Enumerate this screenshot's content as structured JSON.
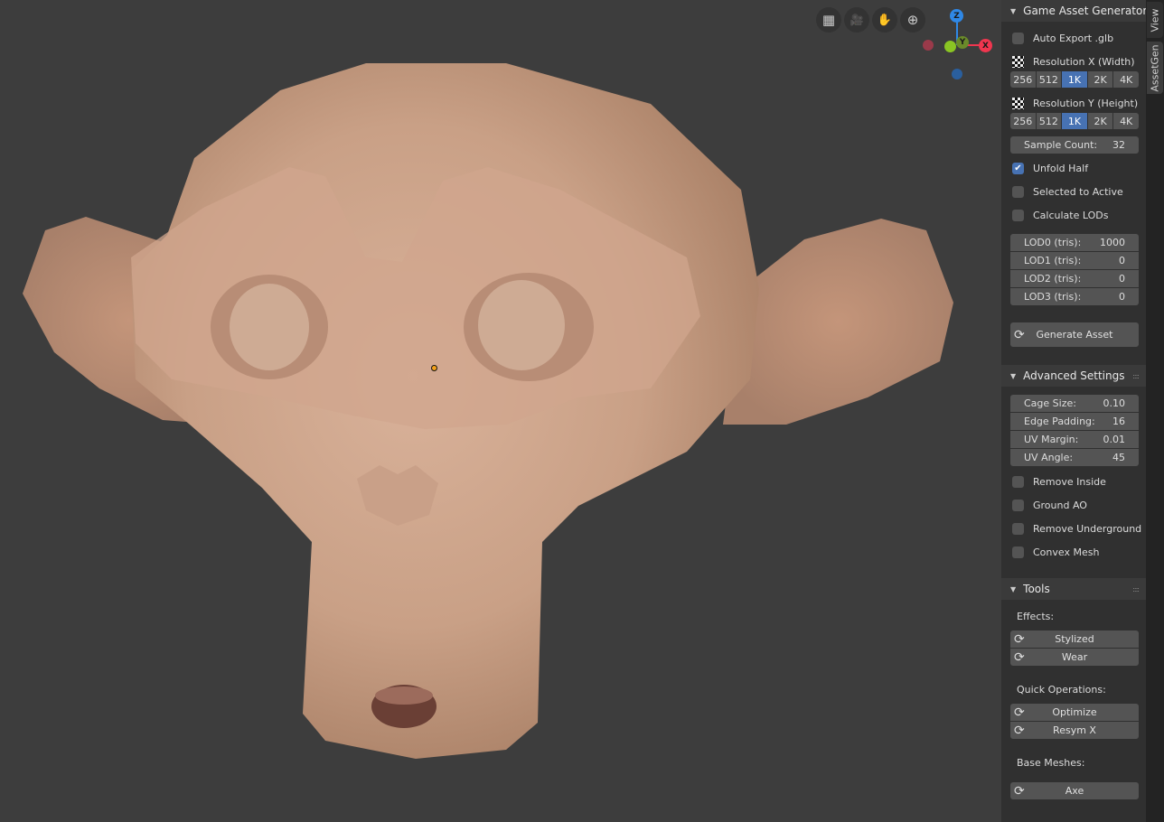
{
  "viewport": {
    "nav_buttons": [
      {
        "icon": "grid-icon",
        "glyph": "▦"
      },
      {
        "icon": "camera-icon",
        "glyph": "🎥"
      },
      {
        "icon": "hand-icon",
        "glyph": "✋"
      },
      {
        "icon": "zoom-icon",
        "glyph": "⊕"
      }
    ],
    "gizmo": {
      "z": "Z",
      "y": "Y",
      "x": "X",
      "colors": {
        "x": "#f0364f",
        "y": "#8ac523",
        "z": "#2f88e6"
      }
    }
  },
  "tabs": {
    "view": "View",
    "assetgen": "AssetGen"
  },
  "panel_main": {
    "title": "Game Asset Generator",
    "auto_export": {
      "label": "Auto Export .glb",
      "checked": false
    },
    "res_x": {
      "label": "Resolution X (Width)",
      "options": [
        "256",
        "512",
        "1K",
        "2K",
        "4K"
      ],
      "selected": "1K"
    },
    "res_y": {
      "label": "Resolution Y (Height)",
      "options": [
        "256",
        "512",
        "1K",
        "2K",
        "4K"
      ],
      "selected": "1K"
    },
    "sample_count": {
      "label": "Sample Count:",
      "value": "32"
    },
    "unfold_half": {
      "label": "Unfold Half",
      "checked": true
    },
    "selected_to_active": {
      "label": "Selected to Active",
      "checked": false
    },
    "calculate_lods": {
      "label": "Calculate LODs",
      "checked": false
    },
    "lods": [
      {
        "label": "LOD0 (tris):",
        "value": "1000"
      },
      {
        "label": "LOD1 (tris):",
        "value": "0"
      },
      {
        "label": "LOD2 (tris):",
        "value": "0"
      },
      {
        "label": "LOD3 (tris):",
        "value": "0"
      }
    ],
    "generate": "Generate Asset"
  },
  "panel_advanced": {
    "title": "Advanced Settings",
    "fields": [
      {
        "label": "Cage Size:",
        "value": "0.10"
      },
      {
        "label": "Edge Padding:",
        "value": "16"
      },
      {
        "label": "UV Margin:",
        "value": "0.01"
      },
      {
        "label": "UV Angle:",
        "value": "45"
      }
    ],
    "checks": [
      {
        "label": "Remove Inside",
        "checked": false
      },
      {
        "label": "Ground AO",
        "checked": false
      },
      {
        "label": "Remove Underground",
        "checked": false
      },
      {
        "label": "Convex Mesh",
        "checked": false
      }
    ]
  },
  "panel_tools": {
    "title": "Tools",
    "effects_label": "Effects:",
    "effects": [
      "Stylized",
      "Wear"
    ],
    "quick_label": "Quick Operations:",
    "quick": [
      "Optimize",
      "Resym X"
    ],
    "base_label": "Base Meshes:",
    "base": [
      "Axe"
    ]
  },
  "check_glyph": "✔",
  "refresh_glyph": "⟳"
}
